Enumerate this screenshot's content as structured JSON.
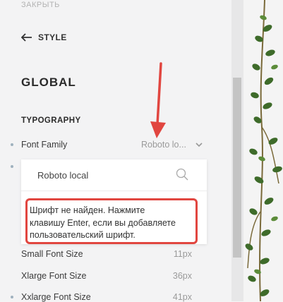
{
  "panel": {
    "close_label": "ЗАКРЫТЬ",
    "back_label": "STYLE",
    "section_title": "GLOBAL",
    "group_title": "TYPOGRAPHY"
  },
  "font_family": {
    "label": "Font Family",
    "value": "Roboto lo...",
    "search_value": "Roboto local",
    "error_lines": [
      "Шрифт не найден. Нажмите",
      "клавишу Enter, если вы добавляете",
      "пользовательский шрифт."
    ]
  },
  "rows": [
    {
      "label": "Small Font Size",
      "value": "11px"
    },
    {
      "label": "Xlarge Font Size",
      "value": "36px"
    },
    {
      "label": "Xxlarge Font Size",
      "value": "41px"
    }
  ],
  "icons": {
    "back": "arrow-left-icon",
    "chevron": "chevron-down-icon",
    "search": "search-icon",
    "annotation": "red-arrow-icon"
  },
  "colors": {
    "accent": "#e14640",
    "panel_bg": "#f3f3f4"
  }
}
